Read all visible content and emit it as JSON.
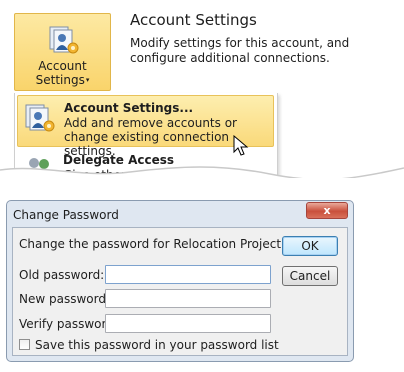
{
  "account_button": {
    "label_line1": "Account",
    "label_line2": "Settings",
    "caret": "▾",
    "icon": "account-settings-icon"
  },
  "account_section": {
    "title": "Account Settings",
    "description": "Modify settings for this account, and configure additional connections."
  },
  "menu": {
    "items": [
      {
        "title": "Account Settings...",
        "description": "Add and remove accounts or change existing connection settings.",
        "icon": "account-settings-icon",
        "selected": true
      },
      {
        "title": "Delegate Access",
        "description": "Give others permission...",
        "icon": "delegate-access-icon",
        "selected": false
      }
    ]
  },
  "dialog": {
    "title": "Change Password",
    "close_label": "x",
    "prompt": "Change the password for Relocation Project.pst:",
    "fields": [
      {
        "label": "Old password:",
        "value": ""
      },
      {
        "label": "New password:",
        "value": ""
      },
      {
        "label": "Verify password:",
        "value": ""
      }
    ],
    "ok_label": "OK",
    "cancel_label": "Cancel",
    "checkbox_label": "Save this password in your password list",
    "checkbox_checked": false
  },
  "colors": {
    "highlight_top": "#fde9a3",
    "highlight_bottom": "#f9d46b",
    "dialog_frame": "#dfe7f1",
    "close_red": "#c9503c"
  }
}
